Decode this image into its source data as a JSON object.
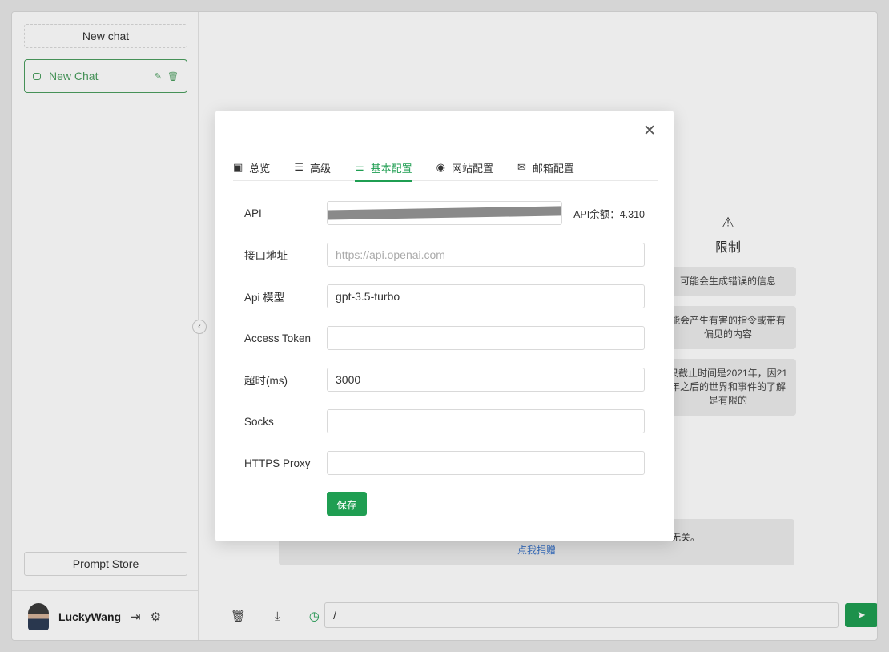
{
  "sidebar": {
    "new_chat_button": "New chat",
    "chat_items": [
      {
        "label": "New Chat",
        "icon": "chat-bubble-icon"
      }
    ],
    "prompt_store": "Prompt Store",
    "user": {
      "name": "LuckyWang"
    }
  },
  "background": {
    "limits_title": "限制",
    "limits": [
      "可能会生成错误的信息",
      "能会产生有害的指令或带有偏见的内容",
      "只截止时间是2021年，因21年之后的世界和事件的了解是有限的"
    ],
    "donate_tail": "无关。",
    "donate_link": "点我捐赠"
  },
  "input": {
    "value": "/"
  },
  "settings": {
    "tabs": [
      {
        "label": "总览",
        "icon": "document-icon"
      },
      {
        "label": "高级",
        "icon": "sliders-icon"
      },
      {
        "label": "基本配置",
        "icon": "config-icon",
        "active": true
      },
      {
        "label": "网站配置",
        "icon": "gear-icon"
      },
      {
        "label": "邮箱配置",
        "icon": "mail-icon"
      }
    ],
    "fields": {
      "api": {
        "label": "API",
        "balance": "API余额：4.310"
      },
      "endpoint": {
        "label": "接口地址",
        "placeholder": "https://api.openai.com",
        "value": ""
      },
      "model": {
        "label": "Api 模型",
        "value": "gpt-3.5-turbo"
      },
      "access_token": {
        "label": "Access Token",
        "value": ""
      },
      "timeout": {
        "label": "超时(ms)",
        "value": "3000"
      },
      "socks": {
        "label": "Socks",
        "value": ""
      },
      "https_proxy": {
        "label": "HTTPS Proxy",
        "value": ""
      }
    },
    "save_button": "保存"
  },
  "colors": {
    "accent": "#1f9e52",
    "chat_border": "#4b9e5f",
    "link": "#3a74c9"
  }
}
